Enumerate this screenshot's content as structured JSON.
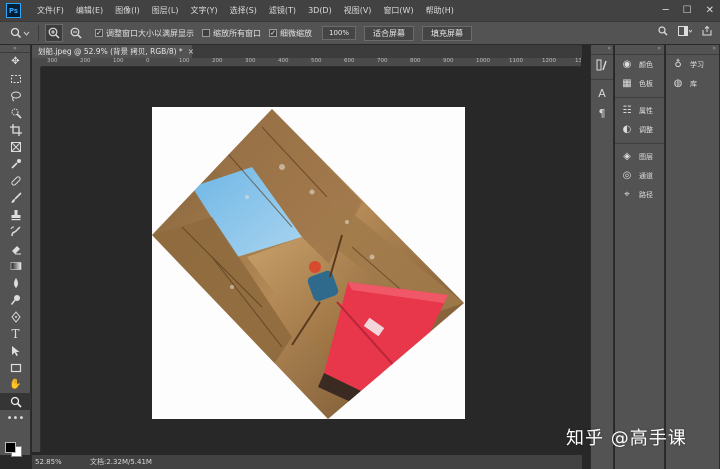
{
  "app": {
    "logo": "Ps"
  },
  "menu": [
    "文件(F)",
    "编辑(E)",
    "图像(I)",
    "图层(L)",
    "文字(Y)",
    "选择(S)",
    "滤镜(T)",
    "3D(D)",
    "视图(V)",
    "窗口(W)",
    "帮助(H)"
  ],
  "options": {
    "resize_windows_label": "调整窗口大小以满屏显示",
    "zoom_all_label": "缩放所有窗口",
    "scrubby_zoom_label": "细微缩放",
    "zoom_value": "100%",
    "fit_screen_label": "适合屏幕",
    "fill_screen_label": "填充屏幕"
  },
  "document": {
    "tab_title": "划船.jpeg @ 52.9% (背景 拷贝, RGB/8) *",
    "ruler_labels": [
      "300",
      "200",
      "100",
      "0",
      "100",
      "200",
      "300",
      "400",
      "500",
      "600",
      "700",
      "800",
      "900",
      "1000",
      "1100",
      "1200",
      "1300"
    ]
  },
  "status": {
    "zoom": "52.85%",
    "doc_size": "文档:2.32M/5.41M"
  },
  "panels": {
    "col1": [
      {
        "icon": "color-icon",
        "label": "颜色"
      },
      {
        "icon": "swatches-icon",
        "label": "色板"
      },
      {
        "icon": "properties-icon",
        "label": "属性"
      },
      {
        "icon": "adjustments-icon",
        "label": "调整"
      },
      {
        "icon": "layers-icon",
        "label": "图层"
      },
      {
        "icon": "channels-icon",
        "label": "通道"
      },
      {
        "icon": "paths-icon",
        "label": "路径"
      }
    ],
    "col2": [
      {
        "icon": "learn-icon",
        "label": "学习"
      },
      {
        "icon": "libraries-icon",
        "label": "库"
      }
    ],
    "strip_labels": {
      "character": "A",
      "paragraph": "¶"
    }
  },
  "watermark": "知乎 @高手课"
}
